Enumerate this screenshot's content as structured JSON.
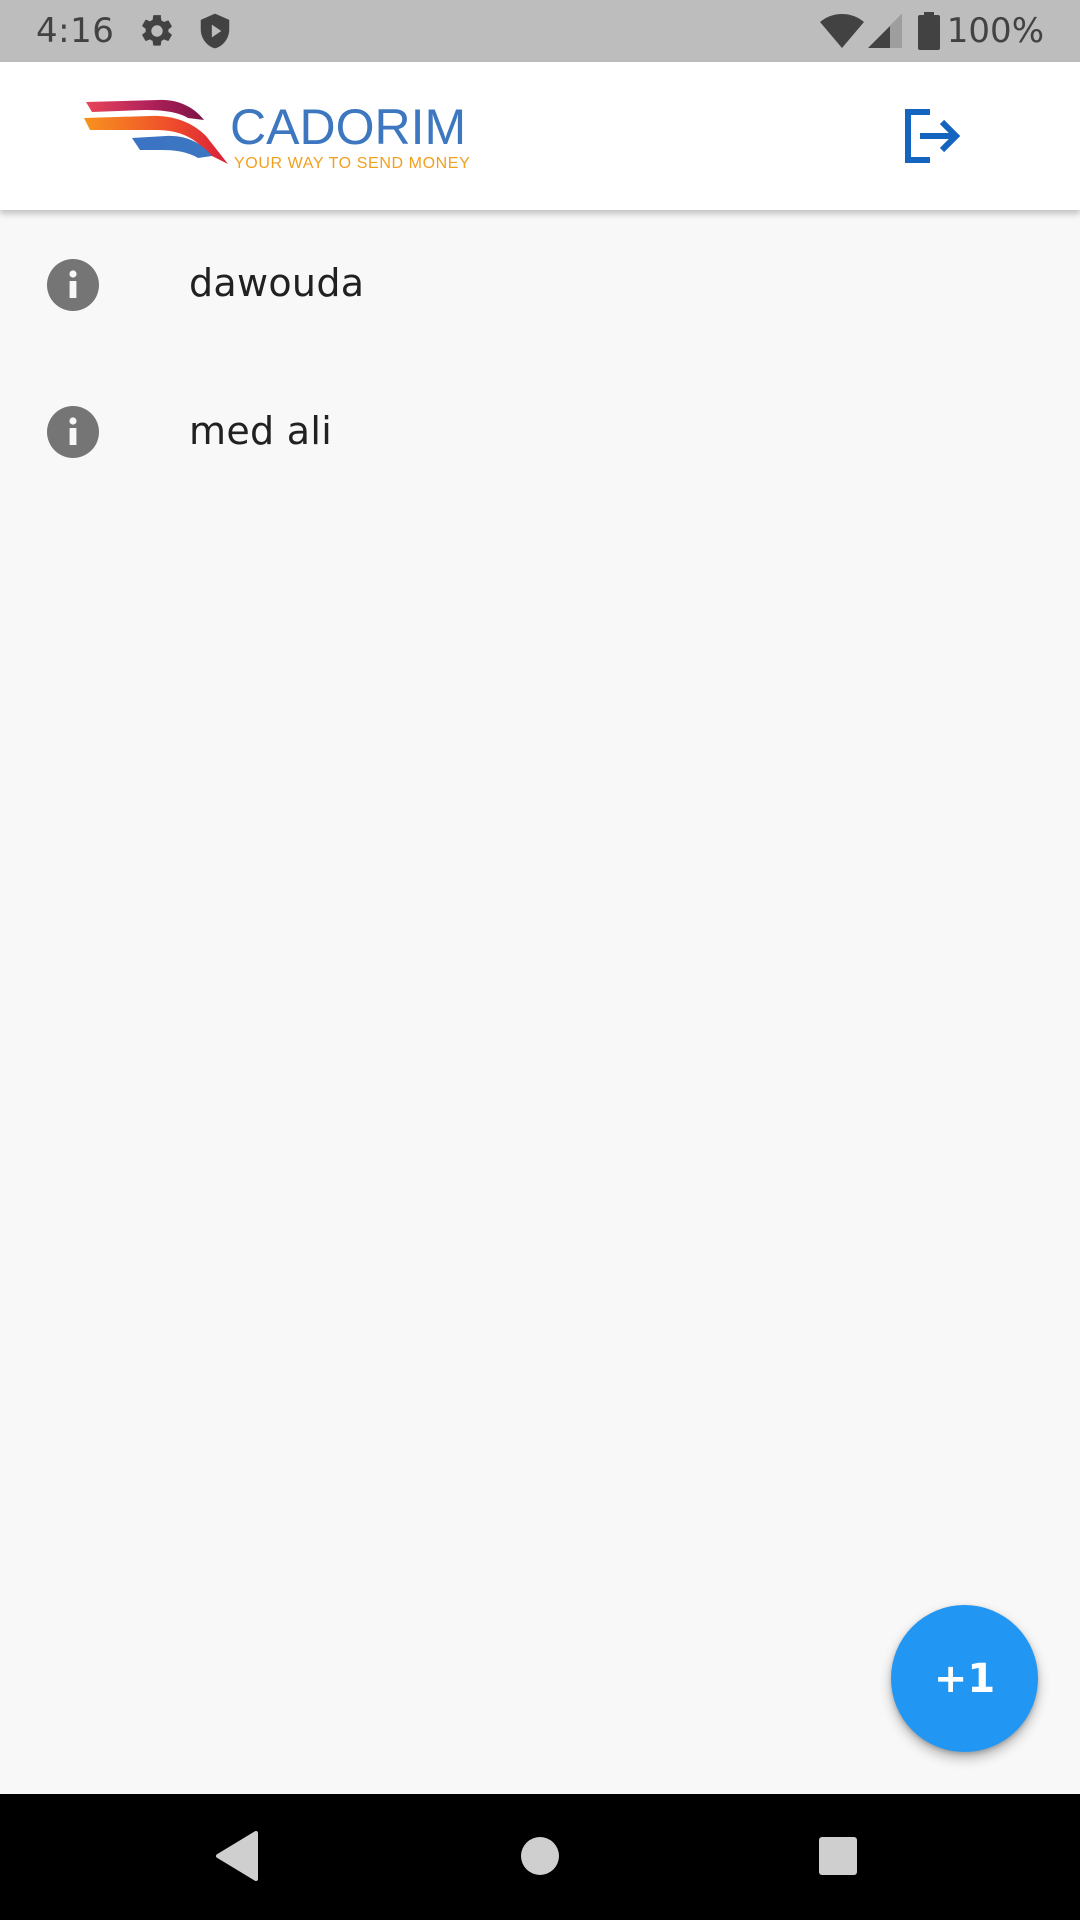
{
  "status_bar": {
    "time": "4:16",
    "battery_percent": "100%",
    "icons": [
      "settings-icon",
      "shield-icon",
      "wifi-icon",
      "signal-icon",
      "battery-icon"
    ]
  },
  "app_bar": {
    "logo": {
      "name": "CADORIM",
      "tagline": "YOUR WAY TO SEND MONEY"
    },
    "actions": [
      "logout-icon"
    ]
  },
  "contacts": [
    {
      "name": "dawouda",
      "icon": "info-icon"
    },
    {
      "name": "med ali",
      "icon": "info-icon"
    }
  ],
  "fab": {
    "label": "+1"
  },
  "nav_bar": {
    "buttons": [
      "back-icon",
      "home-icon",
      "recents-icon"
    ]
  },
  "colors": {
    "status_bar_bg": "#bdbdbd",
    "status_bar_fg": "#424242",
    "app_bar_bg": "#ffffff",
    "page_bg": "#f8f8f8",
    "brand_blue": "#3d77c0",
    "tagline_orange": "#f0a020",
    "logout_icon": "#1565c0",
    "info_icon": "#757575",
    "list_text": "#212121",
    "fab_bg": "#2196f3",
    "nav_bar_bg": "#000000"
  }
}
